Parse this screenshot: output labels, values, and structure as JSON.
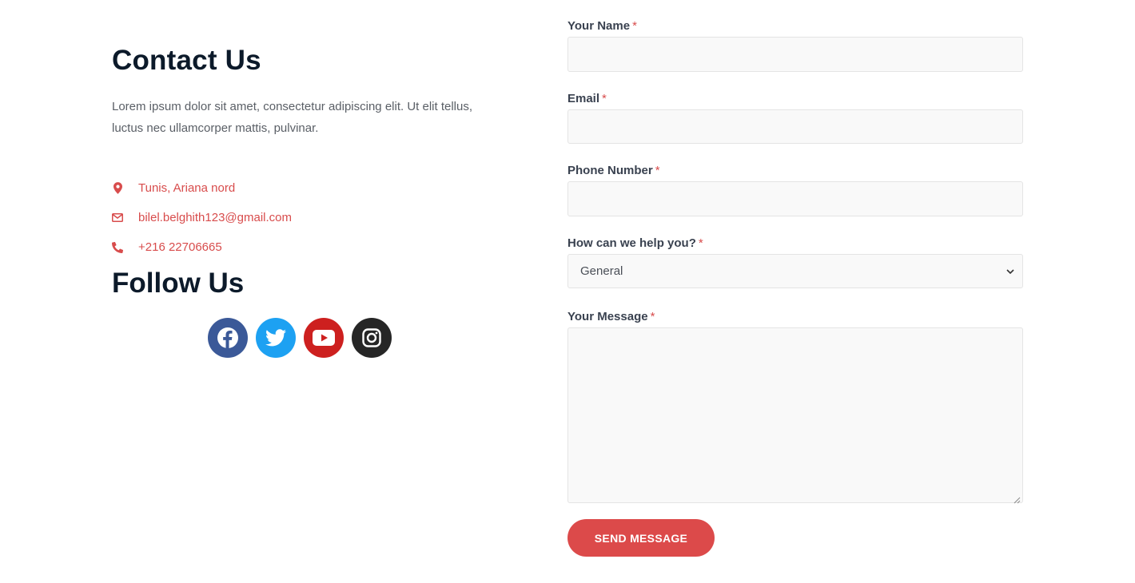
{
  "contact": {
    "title": "Contact Us",
    "description": "Lorem ipsum dolor sit amet, consectetur adipiscing elit. Ut elit tellus, luctus nec ullamcorper mattis, pulvinar.",
    "items": [
      {
        "icon": "map-marker-icon",
        "text": "Tunis, Ariana nord"
      },
      {
        "icon": "envelope-icon",
        "text": "bilel.belghith123@gmail.com"
      },
      {
        "icon": "phone-icon",
        "text": "+216 22706665"
      }
    ],
    "accent_color": "#d84c4c"
  },
  "follow": {
    "title": "Follow Us",
    "socials": [
      {
        "icon": "facebook-icon",
        "color": "#3b5998"
      },
      {
        "icon": "twitter-icon",
        "color": "#1da1f2"
      },
      {
        "icon": "youtube-icon",
        "color": "#cd201f"
      },
      {
        "icon": "instagram-icon",
        "color": "#262626"
      }
    ]
  },
  "form": {
    "required_mark": "*",
    "fields": {
      "name": {
        "label": "Your Name",
        "value": ""
      },
      "email": {
        "label": "Email",
        "value": ""
      },
      "phone": {
        "label": "Phone Number",
        "value": ""
      },
      "help": {
        "label": "How can we help you?",
        "selected": "General"
      },
      "message": {
        "label": "Your Message",
        "value": ""
      }
    },
    "submit_label": "SEND MESSAGE",
    "submit_color": "#dc4a4a"
  }
}
